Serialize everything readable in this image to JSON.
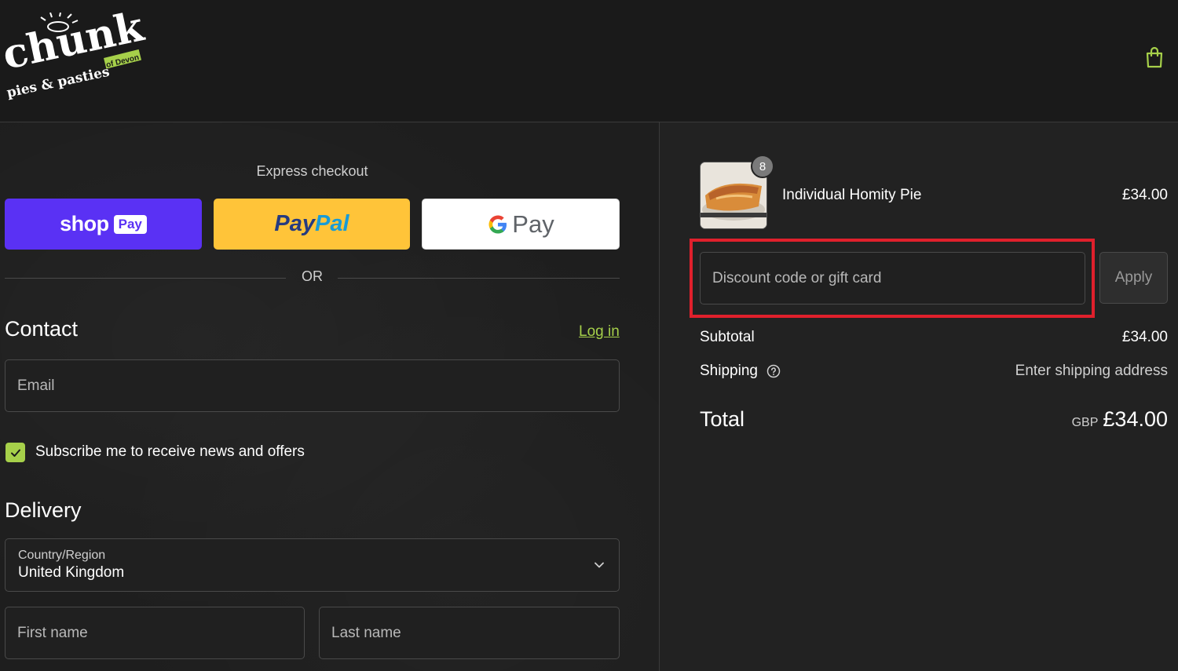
{
  "brand": {
    "logo_main": "chunk",
    "logo_sub": "pies & pasties",
    "logo_tag": "of Devon",
    "accent_color": "#a6d04a"
  },
  "header": {
    "cart_icon": "shopping-bag-icon"
  },
  "express": {
    "title": "Express checkout",
    "shop_label": "shop",
    "shop_badge": "Pay",
    "paypal_part1": "Pay",
    "paypal_part2": "Pal",
    "gpay_g": "G",
    "gpay_label": "Pay",
    "or_label": "OR"
  },
  "contact": {
    "title": "Contact",
    "login_label": "Log in",
    "email_placeholder": "Email",
    "subscribe_label": "Subscribe me to receive news and offers",
    "subscribe_checked": true
  },
  "delivery": {
    "title": "Delivery",
    "country_label": "Country/Region",
    "country_value": "United Kingdom",
    "first_name_placeholder": "First name",
    "last_name_placeholder": "Last name"
  },
  "order": {
    "item": {
      "name": "Individual Homity Pie",
      "price": "£34.00",
      "quantity": "8"
    },
    "discount_placeholder": "Discount code or gift card",
    "apply_label": "Apply",
    "subtotal_label": "Subtotal",
    "subtotal_value": "£34.00",
    "shipping_label": "Shipping",
    "shipping_value": "Enter shipping address",
    "total_label": "Total",
    "total_currency": "GBP",
    "total_value": "£34.00"
  }
}
